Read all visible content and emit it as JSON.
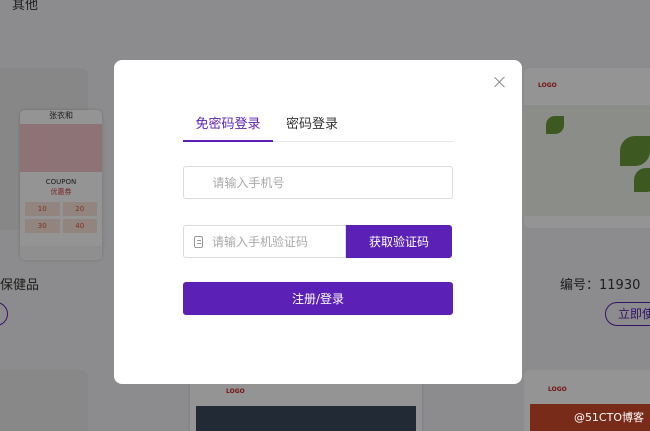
{
  "background": {
    "top_text": "其他",
    "left_caption": "保健品",
    "right_caption": "编号：11930",
    "right_button": "立即使",
    "phone_preview": {
      "brand": "张衣和",
      "coupon_title": "COUPON",
      "coupon_sub": "优惠券",
      "coupon_values": [
        "10",
        "20",
        "30",
        "40"
      ]
    },
    "card_logo": "LOGO",
    "watermark": "@51CTO博客"
  },
  "modal": {
    "tabs": [
      {
        "label": "免密码登录",
        "active": true
      },
      {
        "label": "密码登录",
        "active": false
      }
    ],
    "phone_input": {
      "placeholder": "请输入手机号",
      "value": ""
    },
    "code_input": {
      "placeholder": "请输入手机验证码",
      "value": ""
    },
    "get_code_button": "获取验证码",
    "submit_button": "注册/登录"
  },
  "colors": {
    "accent": "#5b21b6",
    "overlay": "rgba(0,0,0,0.42)"
  },
  "icons": {
    "close": "close-icon",
    "phone": "mobile-phone-icon",
    "code": "document-icon"
  }
}
